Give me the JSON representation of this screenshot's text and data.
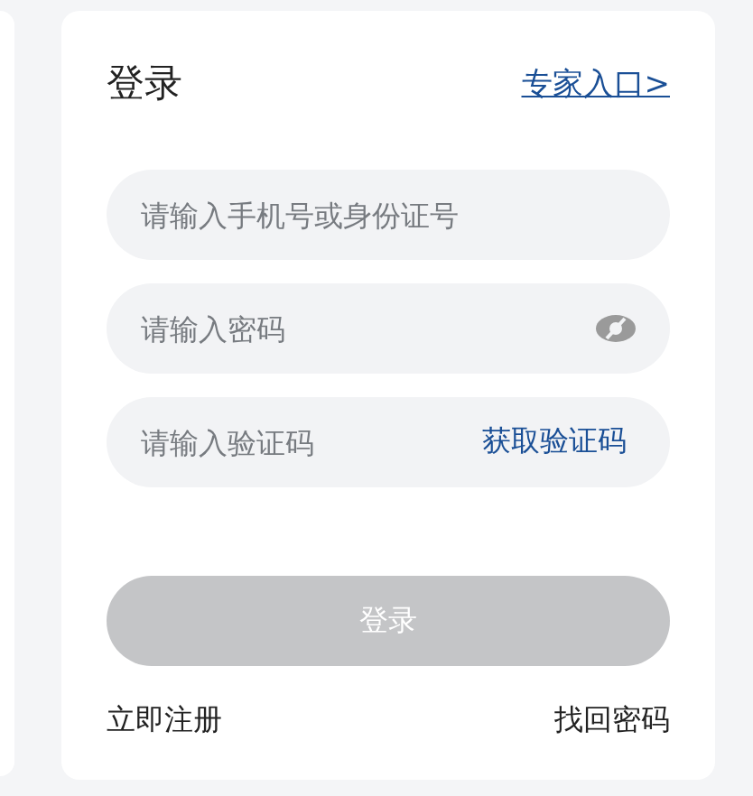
{
  "title": "登录",
  "expert_link": "专家入口>",
  "fields": [
    {
      "kind": "text",
      "placeholder": "请输入手机号或身份证号"
    },
    {
      "kind": "password",
      "placeholder": "请输入密码",
      "password_visible": false
    },
    {
      "kind": "code",
      "placeholder": "请输入验证码",
      "action": "获取验证码"
    }
  ],
  "login_button": {
    "label": "登录",
    "disabled": true
  },
  "register_link": "立即注册",
  "recover_link": "找回密码"
}
